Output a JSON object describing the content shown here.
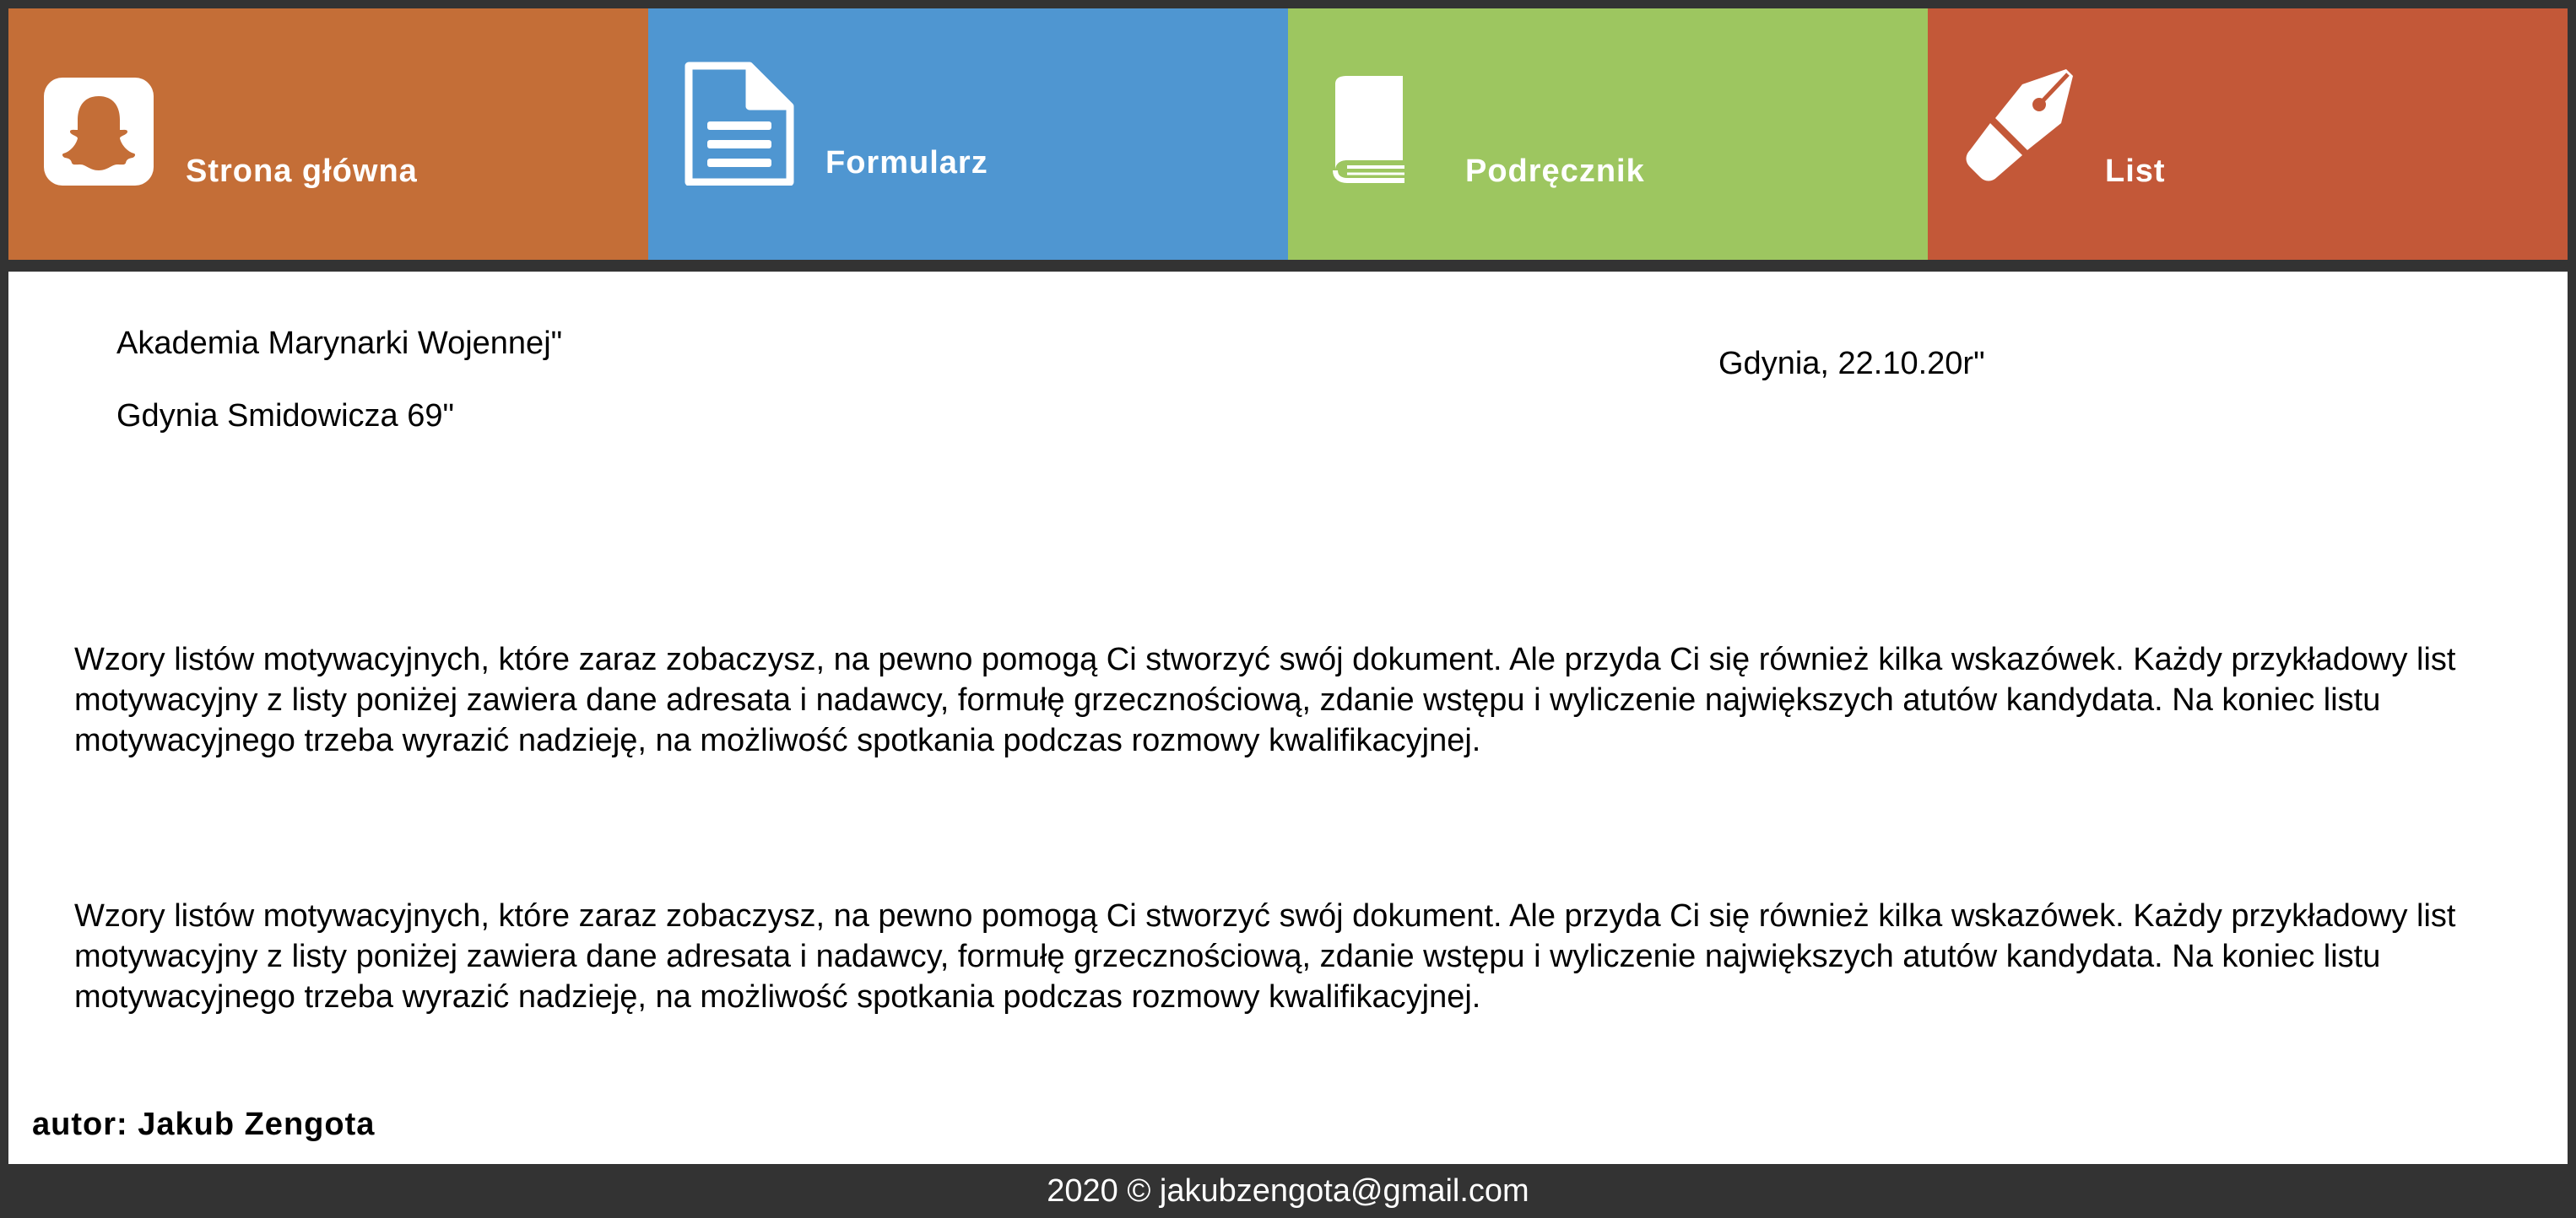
{
  "nav": {
    "items": [
      {
        "label": "Strona główna",
        "icon": "snapchat-icon",
        "color": "#c46e37"
      },
      {
        "label": "Formularz",
        "icon": "document-icon",
        "color": "#4f96d1"
      },
      {
        "label": "Podręcznik",
        "icon": "book-icon",
        "color": "#9dc660"
      },
      {
        "label": "List",
        "icon": "pen-nib-icon",
        "color": "#c35838"
      }
    ]
  },
  "letter": {
    "recipient_line1": "Akademia Marynarki Wojennej\"",
    "recipient_line2": "Gdynia Smidowicza 69\"",
    "date": "Gdynia, 22.10.20r\"",
    "paragraphs": [
      "Wzory listów motywacyjnych, które zaraz zobaczysz, na pewno pomogą Ci stworzyć swój dokument. Ale przyda Ci się również kilka wskazówek. Każdy przykładowy list motywacyjny z listy poniżej zawiera dane adresata i nadawcy, formułę grzecznościową, zdanie wstępu i wyliczenie największych atutów kandydata. Na koniec listu motywacyjnego trzeba wyrazić nadzieję, na możliwość spotkania podczas rozmowy kwalifikacyjnej.",
      "Wzory listów motywacyjnych, które zaraz zobaczysz, na pewno pomogą Ci stworzyć swój dokument. Ale przyda Ci się również kilka wskazówek. Każdy przykładowy list motywacyjny z listy poniżej zawiera dane adresata i nadawcy, formułę grzecznościową, zdanie wstępu i wyliczenie największych atutów kandydata. Na koniec listu motywacyjnego trzeba wyrazić nadzieję, na możliwość spotkania podczas rozmowy kwalifikacyjnej."
    ],
    "author": "autor: Jakub Zengota"
  },
  "footer": {
    "text": "2020 © jakubzengota@gmail.com"
  },
  "colors": {
    "background": "#333333",
    "content": "#ffffff",
    "text": "#000000"
  }
}
